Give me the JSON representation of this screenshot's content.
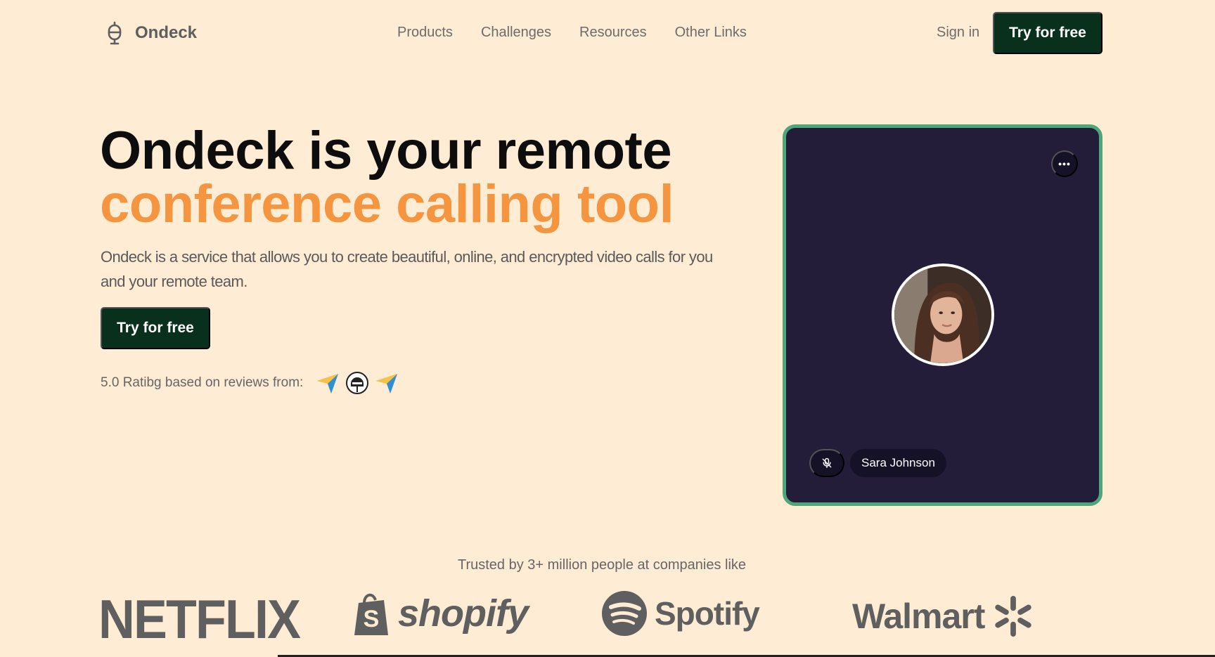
{
  "brand": {
    "name": "Ondeck"
  },
  "nav": {
    "links": [
      "Products",
      "Challenges",
      "Resources",
      "Other Links"
    ],
    "sign_in": "Sign in",
    "cta": "Try for free"
  },
  "hero": {
    "title_line1": "Ondeck is your remote",
    "title_line2": "conference calling tool",
    "description": "Ondeck is a service that allows you to create beautiful, online, and encrypted video calls for you and your remote team.",
    "cta": "Try for free",
    "rating_text": "5.0 Ratibg based on reviews from:"
  },
  "video_card": {
    "more_label": "•••",
    "participant_name": "Sara Johnson",
    "muted": true
  },
  "trusted": {
    "text": "Trusted by 3+ million people at companies like",
    "companies": [
      "NETFLIX",
      "shopify",
      "Spotify",
      "Walmart"
    ]
  },
  "colors": {
    "background": "#ffecd4",
    "primary_dark": "#08301c",
    "accent_orange": "#f5953f",
    "card_bg": "#231d3a",
    "card_border": "#4fa679"
  }
}
